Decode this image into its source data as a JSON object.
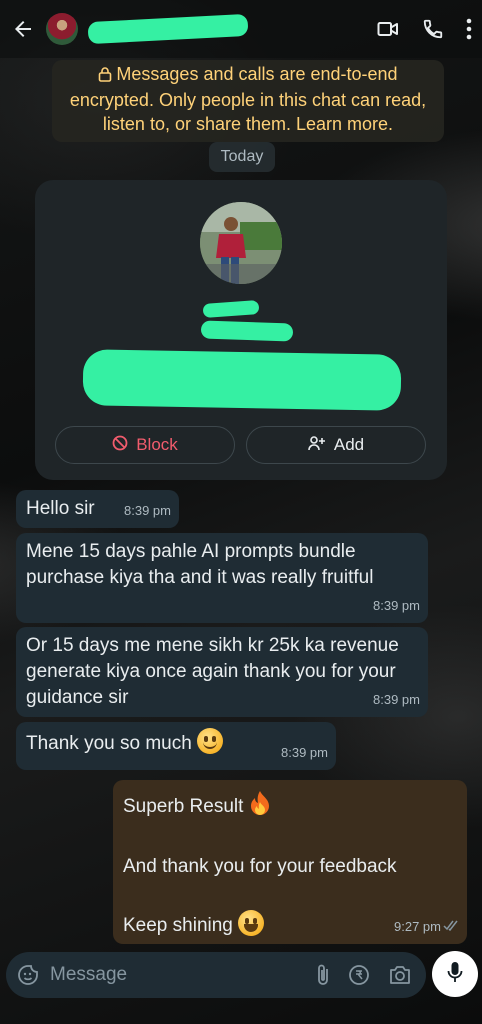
{
  "header": {
    "contact_name": "",
    "icons": [
      "back-arrow-icon",
      "video-call-icon",
      "phone-icon",
      "more-vert-icon"
    ]
  },
  "encryption_notice": "Messages and calls are end-to-end encrypted. Only people in this chat can read, listen to, or share them. Learn more.",
  "date_chip": "Today",
  "contact_card": {
    "block_label": "Block",
    "add_label": "Add"
  },
  "messages": [
    {
      "dir": "in",
      "text": "Hello sir",
      "time": "8:39 pm"
    },
    {
      "dir": "in",
      "text": "Mene 15 days pahle AI prompts bundle purchase kiya tha and it was really fruitful",
      "time": "8:39 pm"
    },
    {
      "dir": "in",
      "text": "Or 15 days me mene sikh kr 25k ka revenue generate kiya once again thank you for your guidance sir",
      "time": "8:39 pm"
    },
    {
      "dir": "in",
      "text": "Thank you so much",
      "time": "8:39 pm",
      "emoji": "smiling-face"
    },
    {
      "dir": "out",
      "lines": [
        "Superb Result",
        "And thank you for your feedback",
        "Keep shining"
      ],
      "time": "9:27 pm",
      "status": "read"
    }
  ],
  "composer": {
    "placeholder": "Message"
  },
  "colors": {
    "incoming_bubble": "#1f2c34",
    "outgoing_bubble": "#3b2d1d",
    "notice_text": "#ffd279",
    "block_red": "#f15c6d",
    "redaction": "#35f0a3"
  }
}
